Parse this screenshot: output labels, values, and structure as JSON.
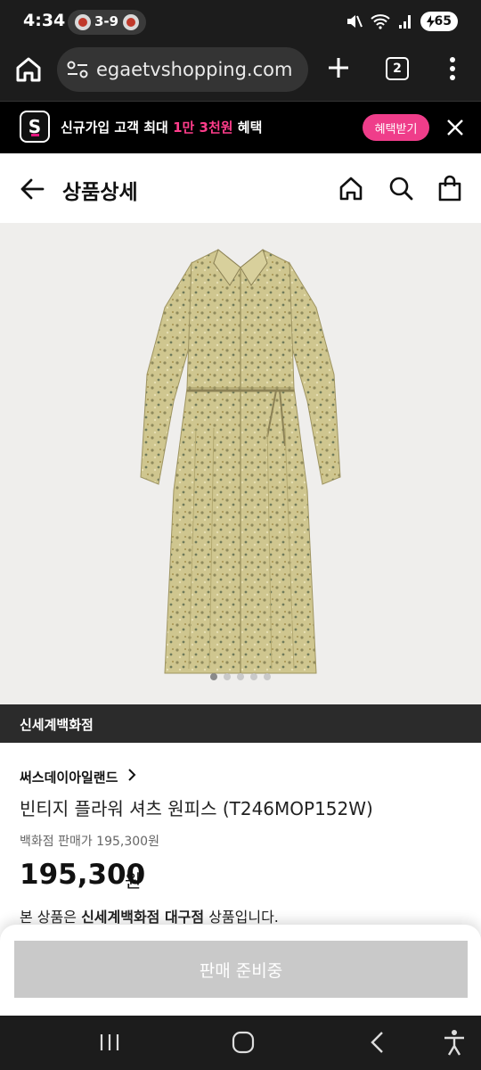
{
  "status_bar": {
    "time": "4:34",
    "score": "3-9",
    "battery": "65"
  },
  "browser": {
    "url": "egaetvshopping.com",
    "tab_count": "2"
  },
  "promo": {
    "logo_letter": "S",
    "text_before": "신규가입 고객 최대 ",
    "text_highlight": "1만 3천원",
    "text_after": " 혜택",
    "button_label": "혜택받기",
    "highlight_color": "#ff3d8b",
    "button_color": "#ef3d8a"
  },
  "header": {
    "title": "상품상세"
  },
  "product": {
    "store": "신세계백화점",
    "brand": "써스데이아일랜드",
    "name": "빈티지 플라워 셔츠 원피스 (T246MOP152W)",
    "dept_price": "백화점 판매가 195,300원",
    "price": "195,300",
    "price_unit": "원",
    "notice_prefix": "본 상품은 ",
    "notice_bold": "신세계백화점 대구점",
    "notice_suffix": " 상품입니다."
  },
  "bottom_sheet": {
    "button_label": "판매 준비중"
  },
  "nav_icons": [
    "recents-icon",
    "home-icon",
    "back-icon",
    "accessibility-icon"
  ]
}
